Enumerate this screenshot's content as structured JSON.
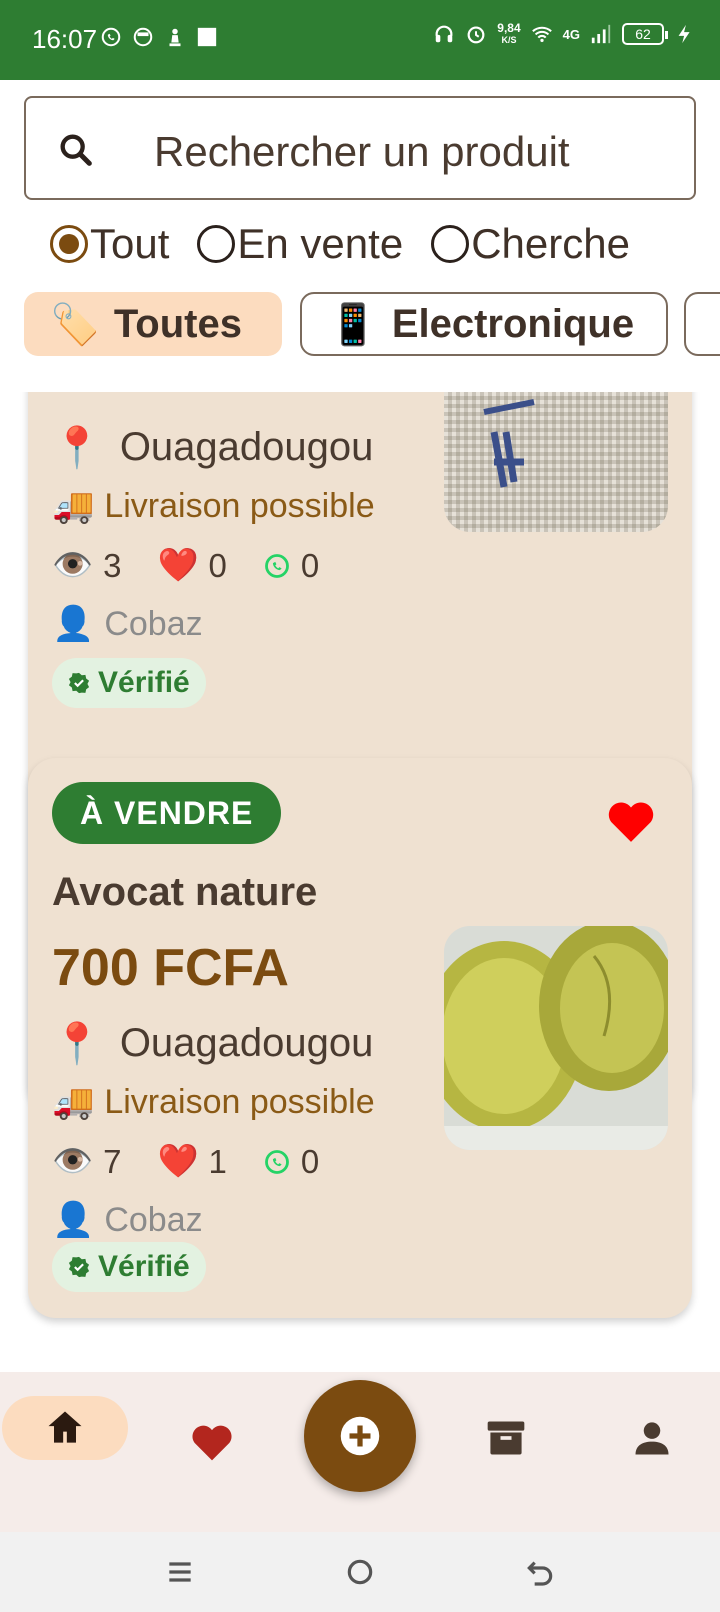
{
  "status_bar": {
    "time": "16:07",
    "net_speed_value": "9,84",
    "net_speed_unit": "K/S",
    "network": "4G",
    "battery": "62"
  },
  "search": {
    "placeholder": "Rechercher un produit"
  },
  "filters": {
    "options": [
      {
        "label": "Tout",
        "selected": true
      },
      {
        "label": "En vente",
        "selected": false
      },
      {
        "label": "Cherche",
        "selected": false
      }
    ]
  },
  "categories": [
    {
      "emoji": "🏷️",
      "label": "Toutes",
      "active": true
    },
    {
      "emoji": "📱",
      "label": "Electronique",
      "active": false
    },
    {
      "emoji": "",
      "label": "",
      "active": false
    }
  ],
  "listings": [
    {
      "badge": "",
      "title": "",
      "price": "",
      "location": "Ouagadougou",
      "delivery": "Livraison possible",
      "views": "3",
      "likes": "0",
      "whatsapp": "0",
      "seller": "Cobaz",
      "verified": "Vérifié"
    },
    {
      "badge": "À VENDRE",
      "title": "Avocat nature",
      "price": "700 FCFA",
      "location": "Ouagadougou",
      "delivery": "Livraison possible",
      "views": "7",
      "likes": "1",
      "whatsapp": "0",
      "seller": "Cobaz",
      "verified": "Vérifié",
      "favorited": true
    }
  ],
  "icons": {
    "pin": "📍",
    "truck": "🚚",
    "eye": "👁️",
    "heart": "❤️",
    "user": "👤"
  },
  "colors": {
    "primary_green": "#2e7d32",
    "brown_accent": "#7b4b10",
    "card_bg": "#efe1d1",
    "chip_active": "#fcdcbf"
  }
}
